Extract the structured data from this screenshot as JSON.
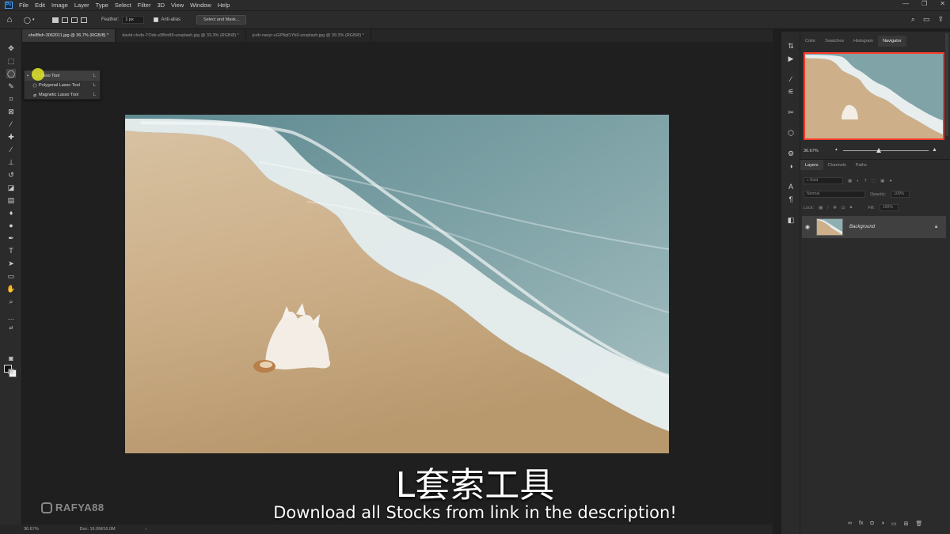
{
  "menubar": {
    "logo": "Ps",
    "items": [
      "File",
      "Edit",
      "Image",
      "Layer",
      "Type",
      "Select",
      "Filter",
      "3D",
      "View",
      "Window",
      "Help"
    ],
    "window_controls": [
      "—",
      "❐",
      "✕"
    ]
  },
  "options": {
    "feather_label": "Feather:",
    "feather_value": "1 px",
    "antialias_label": "Anti-alias",
    "select_and_mask": "Select and Mask..."
  },
  "tabs": [
    "shellfish-3062011.jpg @ 36.7% (RGB/8) *",
    "david-clode-TOsb-s9Bm89-unsplash.jpg @ 33.3% (RGB/8) *",
    "jcob-nasyr-uGP8qf1Yb0-unsplash.jpg @ 39.3% (RGB/8) *"
  ],
  "flyout": {
    "items": [
      {
        "label": "Lasso Tool",
        "key": "L",
        "selected": true
      },
      {
        "label": "Polygonal Lasso Tool",
        "key": "L",
        "selected": false
      },
      {
        "label": "Magnetic Lasso Tool",
        "key": "L",
        "selected": false
      }
    ]
  },
  "status": {
    "zoom": "36.67%",
    "doc": "Doc: 16.0M/16.0M",
    "arrow": "›"
  },
  "watermark": {
    "handle": "RAFYA88"
  },
  "captions": {
    "cn": "L套索工具",
    "en": "Download all Stocks from link in the description!"
  },
  "panels": {
    "top_tabs": [
      "Color",
      "Swatches",
      "Histogram",
      "Navigator"
    ],
    "navigator_zoom": "36.67%",
    "layer_tabs": [
      "Layers",
      "Channels",
      "Paths"
    ],
    "kind_label": "Kind",
    "blend_mode": "Normal",
    "opacity_label": "Opacity:",
    "opacity_value": "100%",
    "lock_label": "Lock:",
    "fill_label": "Fill:",
    "fill_value": "100%",
    "layer_name": "Background"
  },
  "colors": {
    "accent": "#ff3a2a",
    "highlight_cursor": "#e1e628"
  }
}
